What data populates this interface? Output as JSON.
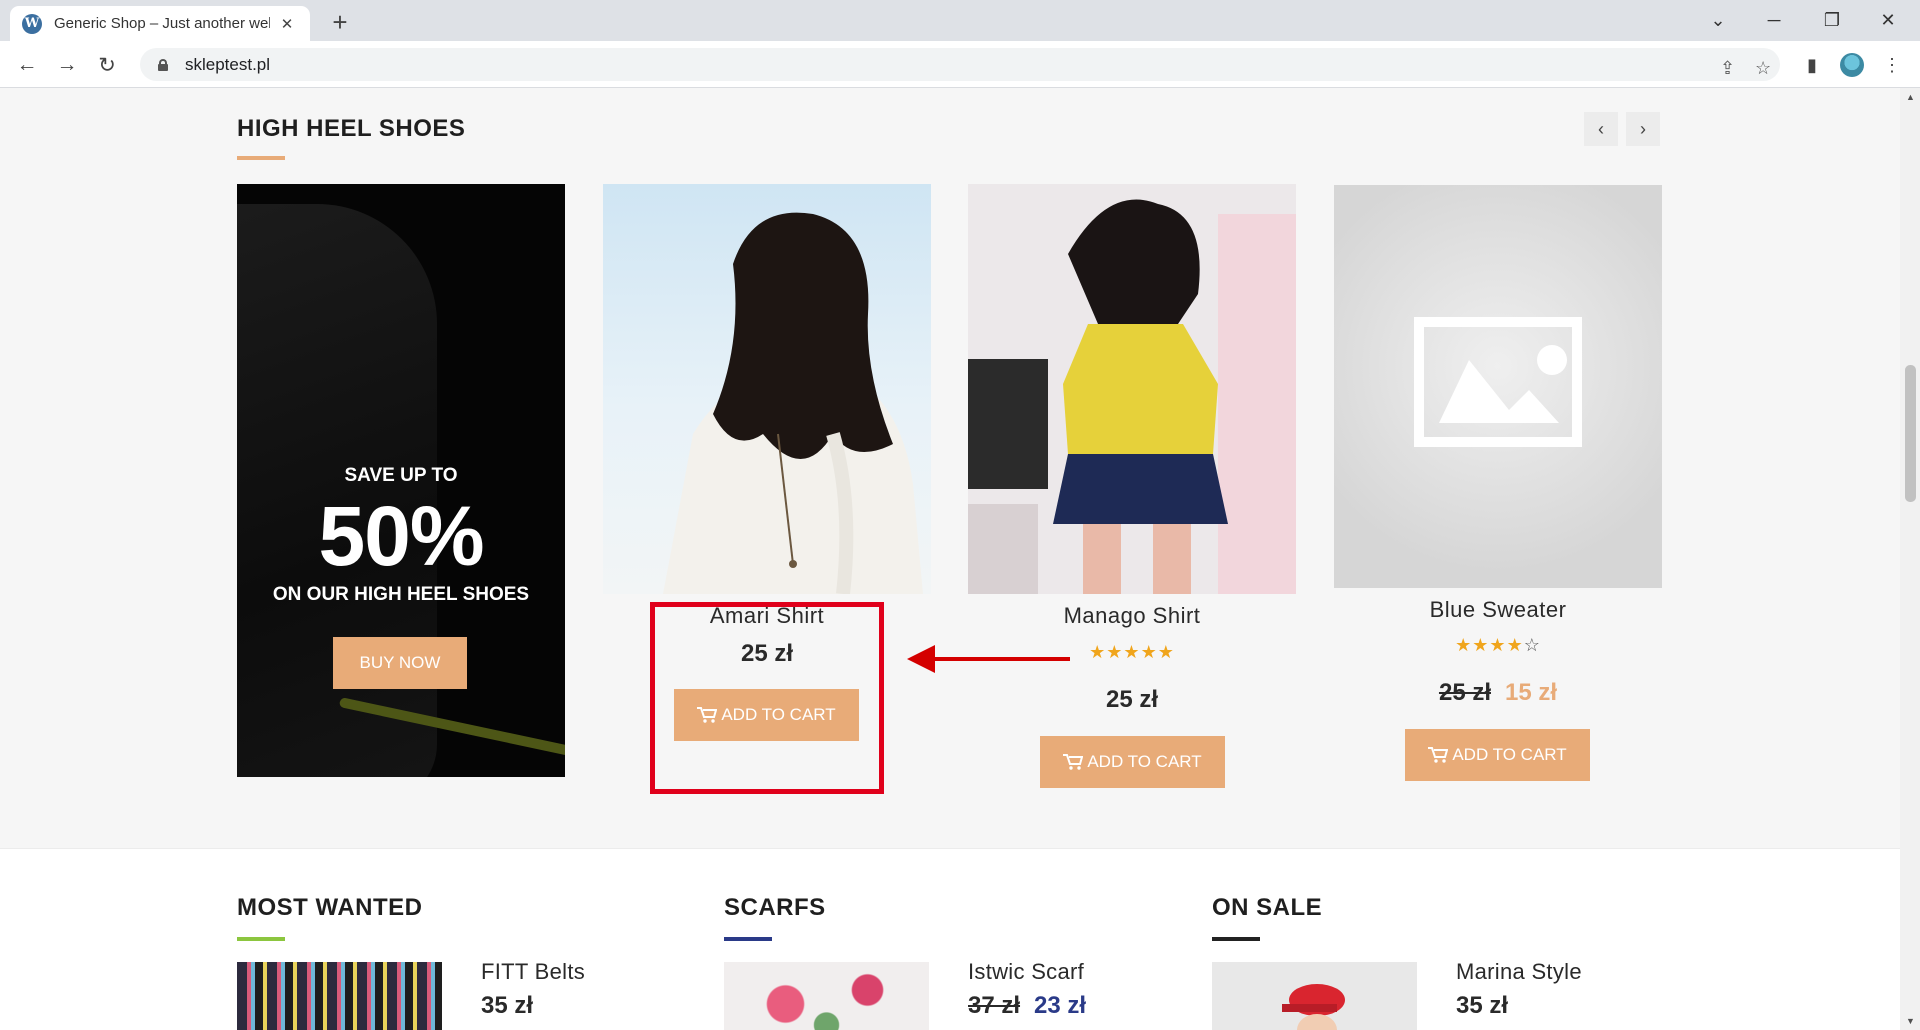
{
  "browser": {
    "tab_title": "Generic Shop – Just another web",
    "tab_favicon": "wordpress-icon",
    "url": "skleptest.pl"
  },
  "colors": {
    "accent": "#e8ab78",
    "navy": "#2a3a88",
    "green": "#8cc63f",
    "highlight": "#e0001b"
  },
  "section": {
    "title": "HIGH HEEL SHOES"
  },
  "promo": {
    "save": "SAVE UP TO",
    "percent": "50%",
    "subtitle": "ON OUR HIGH HEEL SHOES",
    "button": "BUY NOW"
  },
  "products": [
    {
      "name": "Amari Shirt",
      "price": "25 zł",
      "button": "ADD TO CART"
    },
    {
      "name": "Manago Shirt",
      "rating": 5,
      "price": "25 zł",
      "button": "ADD TO CART"
    },
    {
      "name": "Blue Sweater",
      "rating": 4,
      "old_price": "25 zł",
      "price": "15 zł",
      "button": "ADD TO CART"
    }
  ],
  "widgets": [
    {
      "title": "MOST WANTED",
      "item_name": "FITT Belts",
      "price": "35 zł"
    },
    {
      "title": "SCARFS",
      "item_name": "Istwic Scarf",
      "old_price": "37 zł",
      "price": "23 zł"
    },
    {
      "title": "ON SALE",
      "item_name": "Marina Style",
      "price": "35 zł"
    }
  ]
}
